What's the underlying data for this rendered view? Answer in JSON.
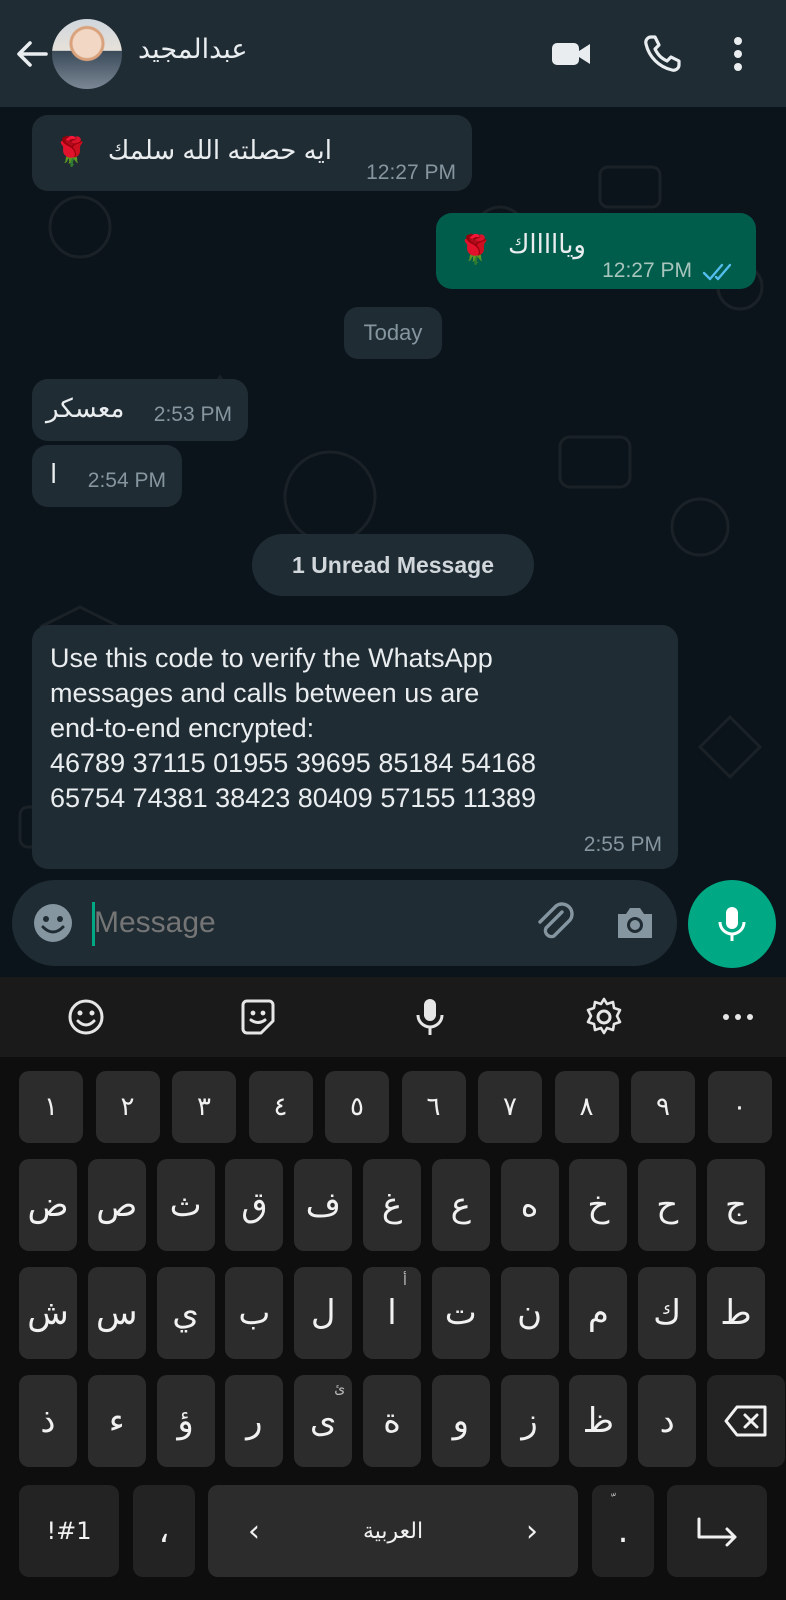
{
  "header": {
    "contact_name": "عبدالمجيد",
    "back_icon": "arrow-left-icon",
    "video_icon": "video-camera-icon",
    "call_icon": "phone-icon",
    "menu_icon": "more-vert-icon"
  },
  "messages": [
    {
      "direction": "incoming",
      "text": "ايه حصلته الله سلمك",
      "emoji": "🌹",
      "time": "12:27 PM"
    },
    {
      "direction": "outgoing",
      "text": "وياااااك",
      "emoji": "🌹",
      "time": "12:27 PM",
      "status": "read"
    },
    {
      "direction": "incoming",
      "text": "معسكر",
      "time": "2:53 PM"
    },
    {
      "direction": "incoming",
      "text": "ا",
      "time": "2:54 PM"
    },
    {
      "direction": "incoming",
      "lines": [
        "Use this code to verify the WhatsApp",
        "messages and calls between us are",
        "end-to-end encrypted:",
        "46789 37115 01955 39695 85184 54168",
        "65754 74381 38423 80409 57155 11389"
      ],
      "time": "2:55 PM"
    }
  ],
  "date_divider": "Today",
  "unread_divider": "1 Unread Message",
  "composer": {
    "placeholder": "Message",
    "emoji_icon": "emoji-icon",
    "attach_icon": "paperclip-icon",
    "camera_icon": "camera-icon",
    "mic_icon": "microphone-icon"
  },
  "keyboard": {
    "toolbar": [
      "emoji-icon",
      "sticker-icon",
      "voice-input-icon",
      "settings-icon",
      "more-horiz-icon"
    ],
    "row_numbers": [
      "١",
      "٢",
      "٣",
      "٤",
      "٥",
      "٦",
      "٧",
      "٨",
      "٩",
      "٠"
    ],
    "row1": [
      "ض",
      "ص",
      "ث",
      "ق",
      "ف",
      "غ",
      "ع",
      "ه",
      "خ",
      "ح",
      "ج"
    ],
    "row2": [
      "ش",
      "س",
      "ي",
      "ب",
      "ل",
      "ا",
      "ت",
      "ن",
      "م",
      "ك",
      "ط"
    ],
    "row2_sup": {
      "ا": "أ"
    },
    "row3": [
      "ذ",
      "ء",
      "ؤ",
      "ر",
      "ى",
      "ة",
      "و",
      "ز",
      "ظ",
      "د"
    ],
    "row3_sup": {
      "ى": "ئ"
    },
    "symbols_key": "!#1",
    "comma_key": "،",
    "space_label": "العربية",
    "left_arrow": "‹",
    "right_arrow": "›",
    "period_key": ".",
    "period_sup": "ّ"
  },
  "colors": {
    "accent": "#00a884",
    "outgoing_bubble": "#005c4b",
    "incoming_bubble": "#202c33",
    "header": "#1f2c34",
    "read_ticks": "#53bdeb"
  }
}
